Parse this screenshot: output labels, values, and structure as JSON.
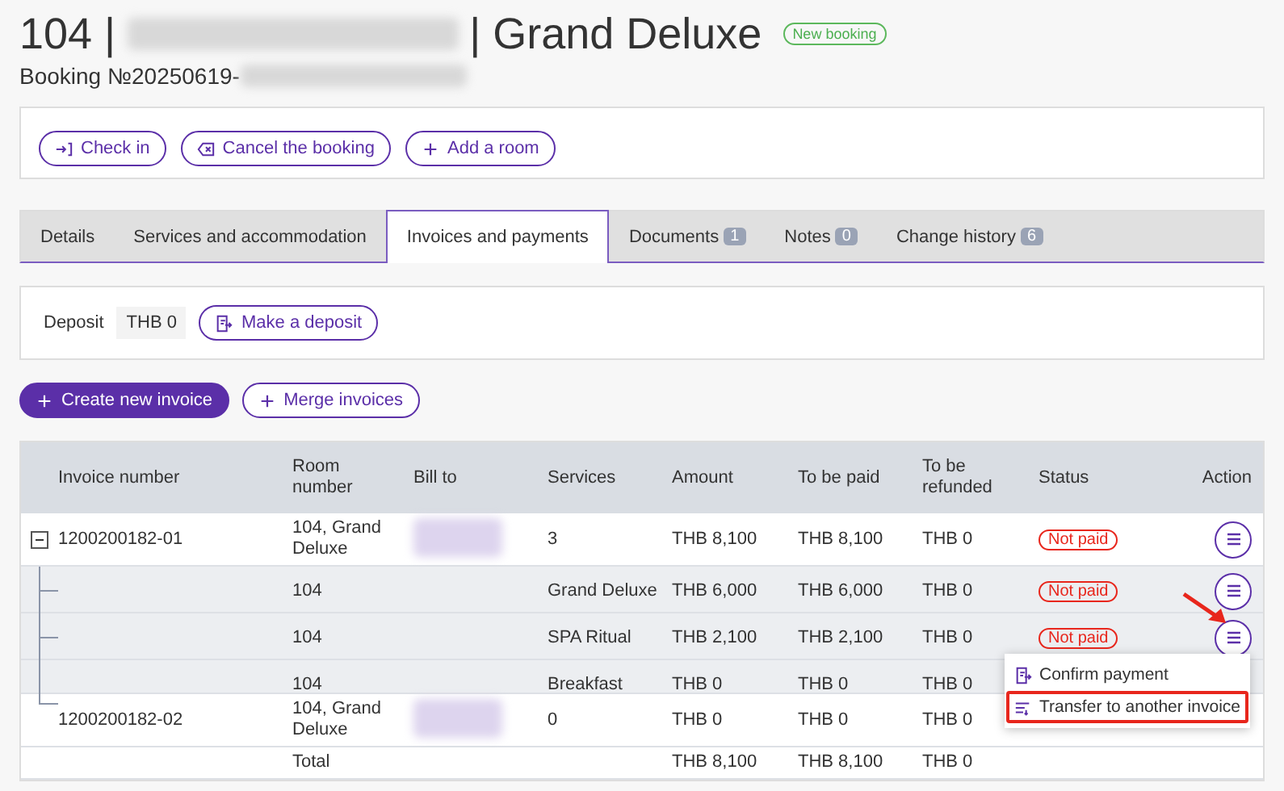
{
  "header": {
    "title_start": "104 |",
    "title_end": "| Grand Deluxe",
    "badge": "New booking",
    "booking": "Booking №20250619-"
  },
  "booking_actions": [
    {
      "label": "Check in",
      "kind": "check-in"
    },
    {
      "label": "Cancel the booking",
      "kind": "cancel"
    },
    {
      "label": "Add a room",
      "kind": "add"
    }
  ],
  "tabs": [
    {
      "label": "Details",
      "selected": false
    },
    {
      "label": "Services and accommodation",
      "selected": false
    },
    {
      "label": "Invoices and payments",
      "selected": true
    },
    {
      "label": "Documents",
      "count": "1",
      "selected": false
    },
    {
      "label": "Notes",
      "count": "0",
      "selected": false
    },
    {
      "label": "Change history",
      "count": "6",
      "selected": false
    }
  ],
  "deposit": {
    "label": "Deposit",
    "value": "THB 0",
    "button": "Make a deposit"
  },
  "invoice_actions": [
    {
      "label": "Create new invoice",
      "kind": "primary"
    },
    {
      "label": "Merge invoices",
      "kind": "secondary"
    }
  ],
  "table": {
    "columns": [
      "Invoice number",
      "Room number",
      "Bill to",
      "Services",
      "Amount",
      "To be paid",
      "To be refunded",
      "Status",
      "Action"
    ],
    "rows": [
      {
        "kind": "invoice",
        "expanded": true,
        "number": "1200200182-01",
        "room": "104, Grand Deluxe",
        "services": "3",
        "amount": "THB 8,100",
        "to_pay": "THB 8,100",
        "refund": "THB 0",
        "status": {
          "text": "Not paid",
          "kind": "unpaid"
        },
        "action": true,
        "children": [
          {
            "kind": "item",
            "room": "104",
            "services": "Grand Deluxe",
            "amount": "THB 6,000",
            "to_pay": "THB 6,000",
            "refund": "THB 0",
            "status": {
              "text": "Not paid",
              "kind": "unpaid"
            },
            "action": true
          },
          {
            "kind": "item",
            "room": "104",
            "services": "SPA Ritual",
            "amount": "THB 2,100",
            "to_pay": "THB 2,100",
            "refund": "THB 0",
            "status": {
              "text": "Not paid",
              "kind": "unpaid"
            },
            "action": true
          },
          {
            "kind": "item",
            "room": "104",
            "services": "Breakfast",
            "amount": "THB 0",
            "to_pay": "THB 0",
            "refund": "THB 0"
          }
        ]
      },
      {
        "kind": "invoice",
        "number": "1200200182-02",
        "room": "104, Grand Deluxe",
        "services": "0",
        "amount": "THB 0",
        "to_pay": "THB 0",
        "refund": "THB 0"
      },
      {
        "kind": "total",
        "room": "Total",
        "amount": "THB 8,100",
        "to_pay": "THB 8,100",
        "refund": "THB 0"
      }
    ]
  },
  "action_menu": {
    "items": [
      {
        "label": "Confirm payment",
        "kind": "confirm",
        "highlighted": false
      },
      {
        "label": "Transfer to another invoice",
        "kind": "transfer",
        "highlighted": true
      }
    ]
  }
}
